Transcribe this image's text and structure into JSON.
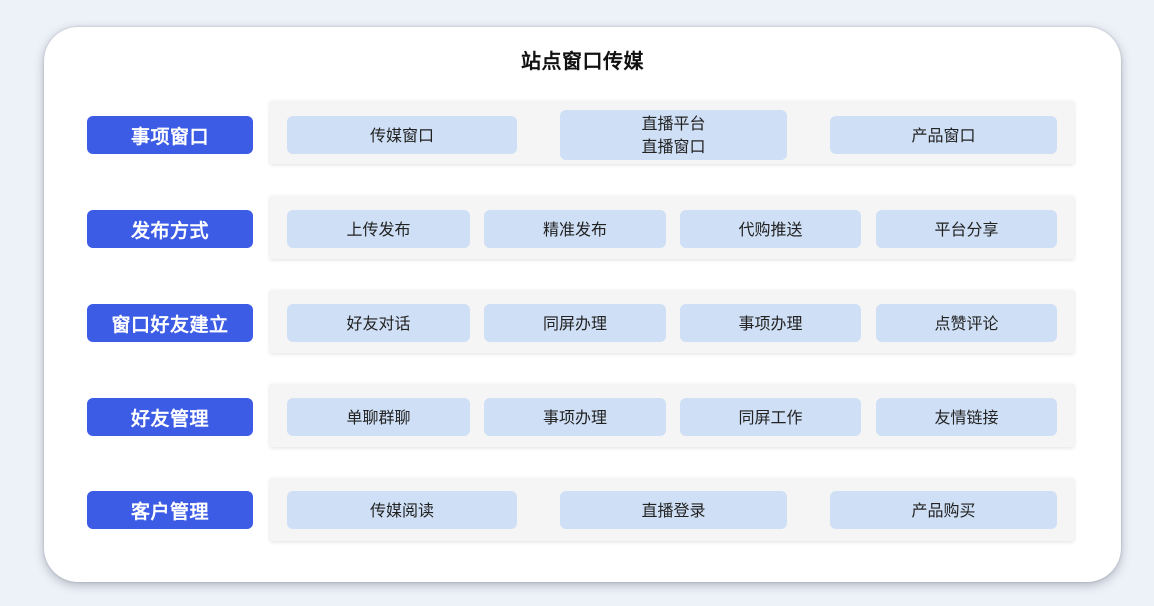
{
  "title": "站点窗口传媒",
  "colors": {
    "label_bg": "#3d5ce6",
    "chip_bg": "#cfdff5",
    "panel_bg": "#f5f5f5"
  },
  "rows": [
    {
      "label": "事项窗口",
      "items": [
        {
          "lines": [
            "传媒窗口"
          ]
        },
        {
          "lines": [
            "直播平台",
            "直播窗口"
          ]
        },
        {
          "lines": [
            "产品窗口"
          ]
        }
      ]
    },
    {
      "label": "发布方式",
      "items": [
        {
          "lines": [
            "上传发布"
          ]
        },
        {
          "lines": [
            "精准发布"
          ]
        },
        {
          "lines": [
            "代购推送"
          ]
        },
        {
          "lines": [
            "平台分享"
          ]
        }
      ]
    },
    {
      "label": "窗口好友建立",
      "items": [
        {
          "lines": [
            "好友对话"
          ]
        },
        {
          "lines": [
            "同屏办理"
          ]
        },
        {
          "lines": [
            "事项办理"
          ]
        },
        {
          "lines": [
            "点赞评论"
          ]
        }
      ]
    },
    {
      "label": "好友管理",
      "items": [
        {
          "lines": [
            "单聊群聊"
          ]
        },
        {
          "lines": [
            "事项办理"
          ]
        },
        {
          "lines": [
            "同屏工作"
          ]
        },
        {
          "lines": [
            "友情链接"
          ]
        }
      ]
    },
    {
      "label": "客户管理",
      "items": [
        {
          "lines": [
            "传媒阅读"
          ]
        },
        {
          "lines": [
            "直播登录"
          ]
        },
        {
          "lines": [
            "产品购买"
          ]
        }
      ]
    }
  ]
}
